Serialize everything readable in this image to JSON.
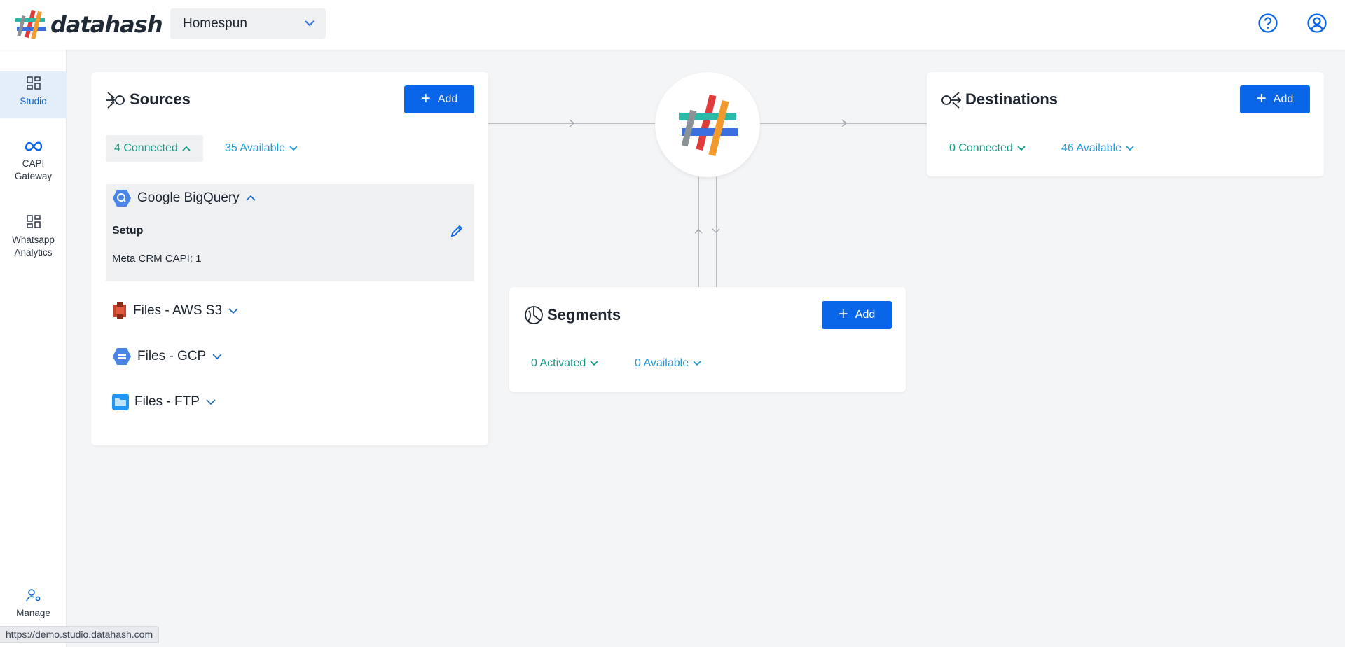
{
  "app": {
    "logo_text": "datahash"
  },
  "header": {
    "workspace": "Homespun"
  },
  "sidebar": {
    "items": [
      {
        "label": "Studio",
        "icon": "dashboard-icon"
      },
      {
        "label": "CAPI Gateway",
        "icon": "meta-icon"
      },
      {
        "label": "Whatsapp Analytics",
        "icon": "dashboard-icon"
      },
      {
        "label": "Manage",
        "icon": "user-gear-icon"
      }
    ]
  },
  "sources": {
    "title": "Sources",
    "add_label": "Add",
    "connected": "4 Connected",
    "available": "35 Available",
    "items": [
      {
        "name": "Google BigQuery",
        "expanded": true,
        "setup_label": "Setup",
        "detail": "Meta CRM CAPI: 1"
      },
      {
        "name": "Files - AWS S3"
      },
      {
        "name": "Files - GCP"
      },
      {
        "name": "Files - FTP"
      }
    ]
  },
  "destinations": {
    "title": "Destinations",
    "add_label": "Add",
    "connected": "0 Connected",
    "available": "46 Available"
  },
  "segments": {
    "title": "Segments",
    "add_label": "Add",
    "activated": "0 Activated",
    "available": "0 Available"
  },
  "status_url": "https://demo.studio.datahash.com",
  "colors": {
    "primary": "#0a66e8",
    "teal": "#0f9b84",
    "link_blue": "#1e9ad6"
  }
}
